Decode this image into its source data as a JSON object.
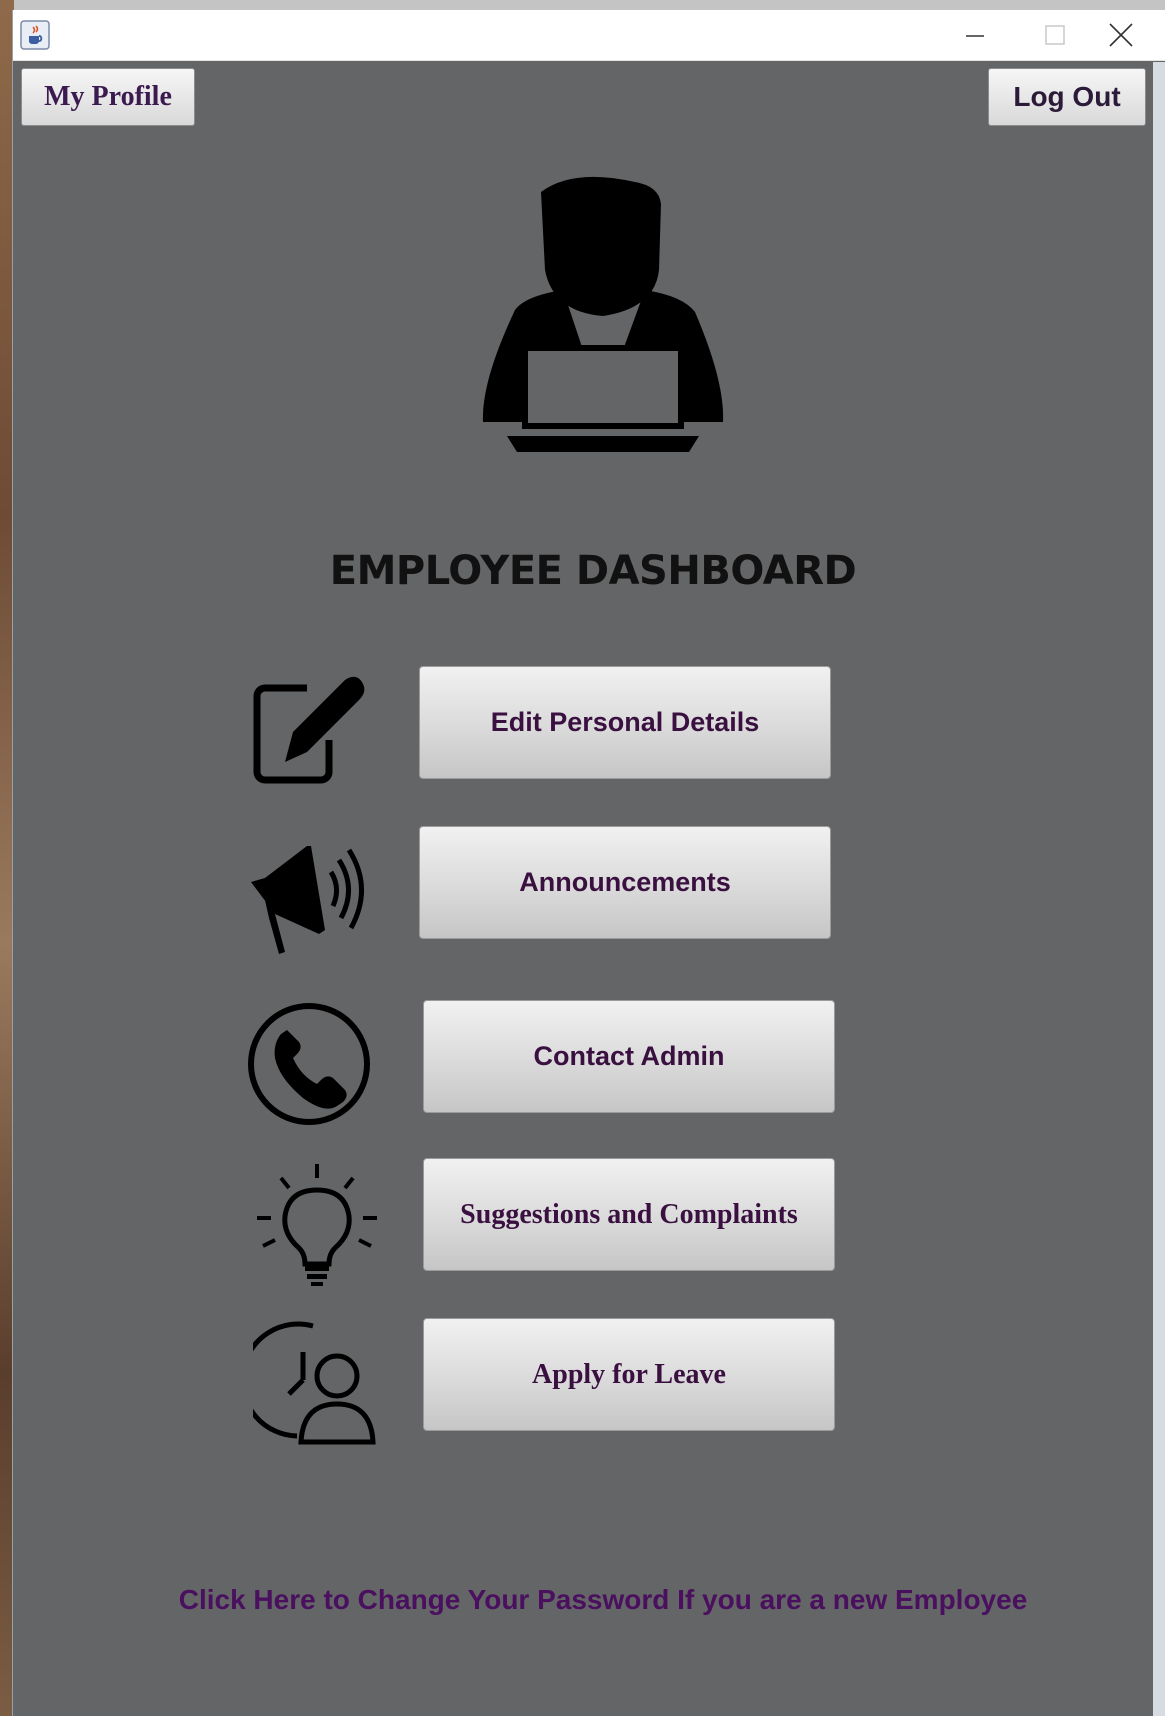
{
  "window": {
    "minimize_glyph": "—",
    "maximize_glyph": "☐",
    "close_glyph": "✕",
    "app_icon": "java-coffee-cup-icon"
  },
  "header": {
    "profile_label": "My Profile",
    "logout_label": "Log Out"
  },
  "dashboard": {
    "title": "EMPLOYEE DASHBOARD",
    "avatar_icon": "employee-at-laptop-icon"
  },
  "menu": [
    {
      "label": "Edit Personal Details",
      "icon": "edit-square-pencil-icon"
    },
    {
      "label": "Announcements",
      "icon": "megaphone-icon"
    },
    {
      "label": "Contact Admin",
      "icon": "phone-circle-icon"
    },
    {
      "label": "Suggestions and Complaints",
      "icon": "lightbulb-icon"
    },
    {
      "label": "Apply for Leave",
      "icon": "clock-person-icon"
    }
  ],
  "footer": {
    "password_link": "Click Here to Change Your Password If you are a new Employee"
  },
  "colors": {
    "panel_bg": "#646566",
    "button_text": "#3a1040",
    "link_text": "#4a0f5e"
  }
}
